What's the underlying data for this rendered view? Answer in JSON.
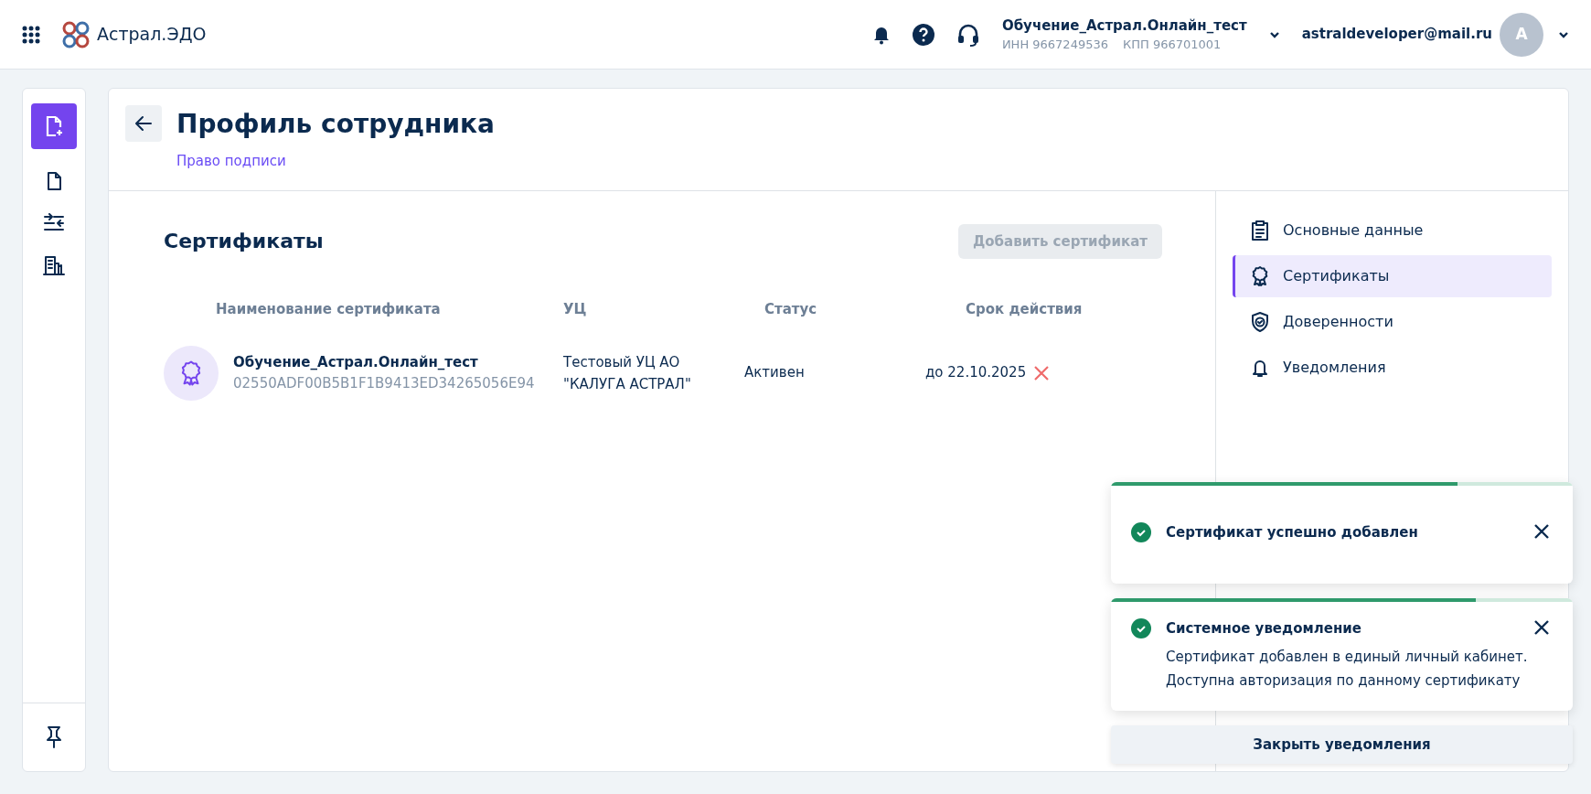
{
  "header": {
    "app_title": "Астрал.ЭДО",
    "org": {
      "name": "Обучение_Астрал.Онлайн_тест",
      "inn": "ИНН 9667249536",
      "kpp": "КПП 966701001"
    },
    "email": "astraldeveloper@mail.ru",
    "avatar": "А"
  },
  "page": {
    "title": "Профиль сотрудника",
    "subtitle": "Право подписи"
  },
  "section": {
    "title": "Сертификаты",
    "add_button": {
      "label": "Добавить сертификат",
      "disabled": true
    }
  },
  "table": {
    "columns": [
      "Наименование сертификата",
      "УЦ",
      "Статус",
      "Срок действия"
    ],
    "rows": [
      {
        "name": "Обучение_Астрал.Онлайн_тест",
        "serial": "02550ADF00B5B1F1B9413ED34265056E94",
        "ca": [
          "Тестовый УЦ АО",
          "\"КАЛУГА АСТРАЛ\""
        ],
        "status": "Активен",
        "expiry": "до 22.10.2025"
      }
    ]
  },
  "profile_nav": [
    {
      "label": "Основные данные",
      "kind": "clipboard",
      "selected": false
    },
    {
      "label": "Сертификаты",
      "kind": "award",
      "selected": true
    },
    {
      "label": "Доверенности",
      "kind": "shield",
      "selected": false
    },
    {
      "label": "Уведомления",
      "kind": "bell",
      "selected": false
    }
  ],
  "toasts": [
    {
      "title": "Сертификат успешно добавлен",
      "level": 0.75
    },
    {
      "title": "Системное уведомление",
      "body": [
        "Сертификат добавлен в единый личный кабинет.",
        "Доступна авторизация по данному сертификату"
      ],
      "level": 0.79
    }
  ],
  "close_all_button": "Закрыть уведомления"
}
